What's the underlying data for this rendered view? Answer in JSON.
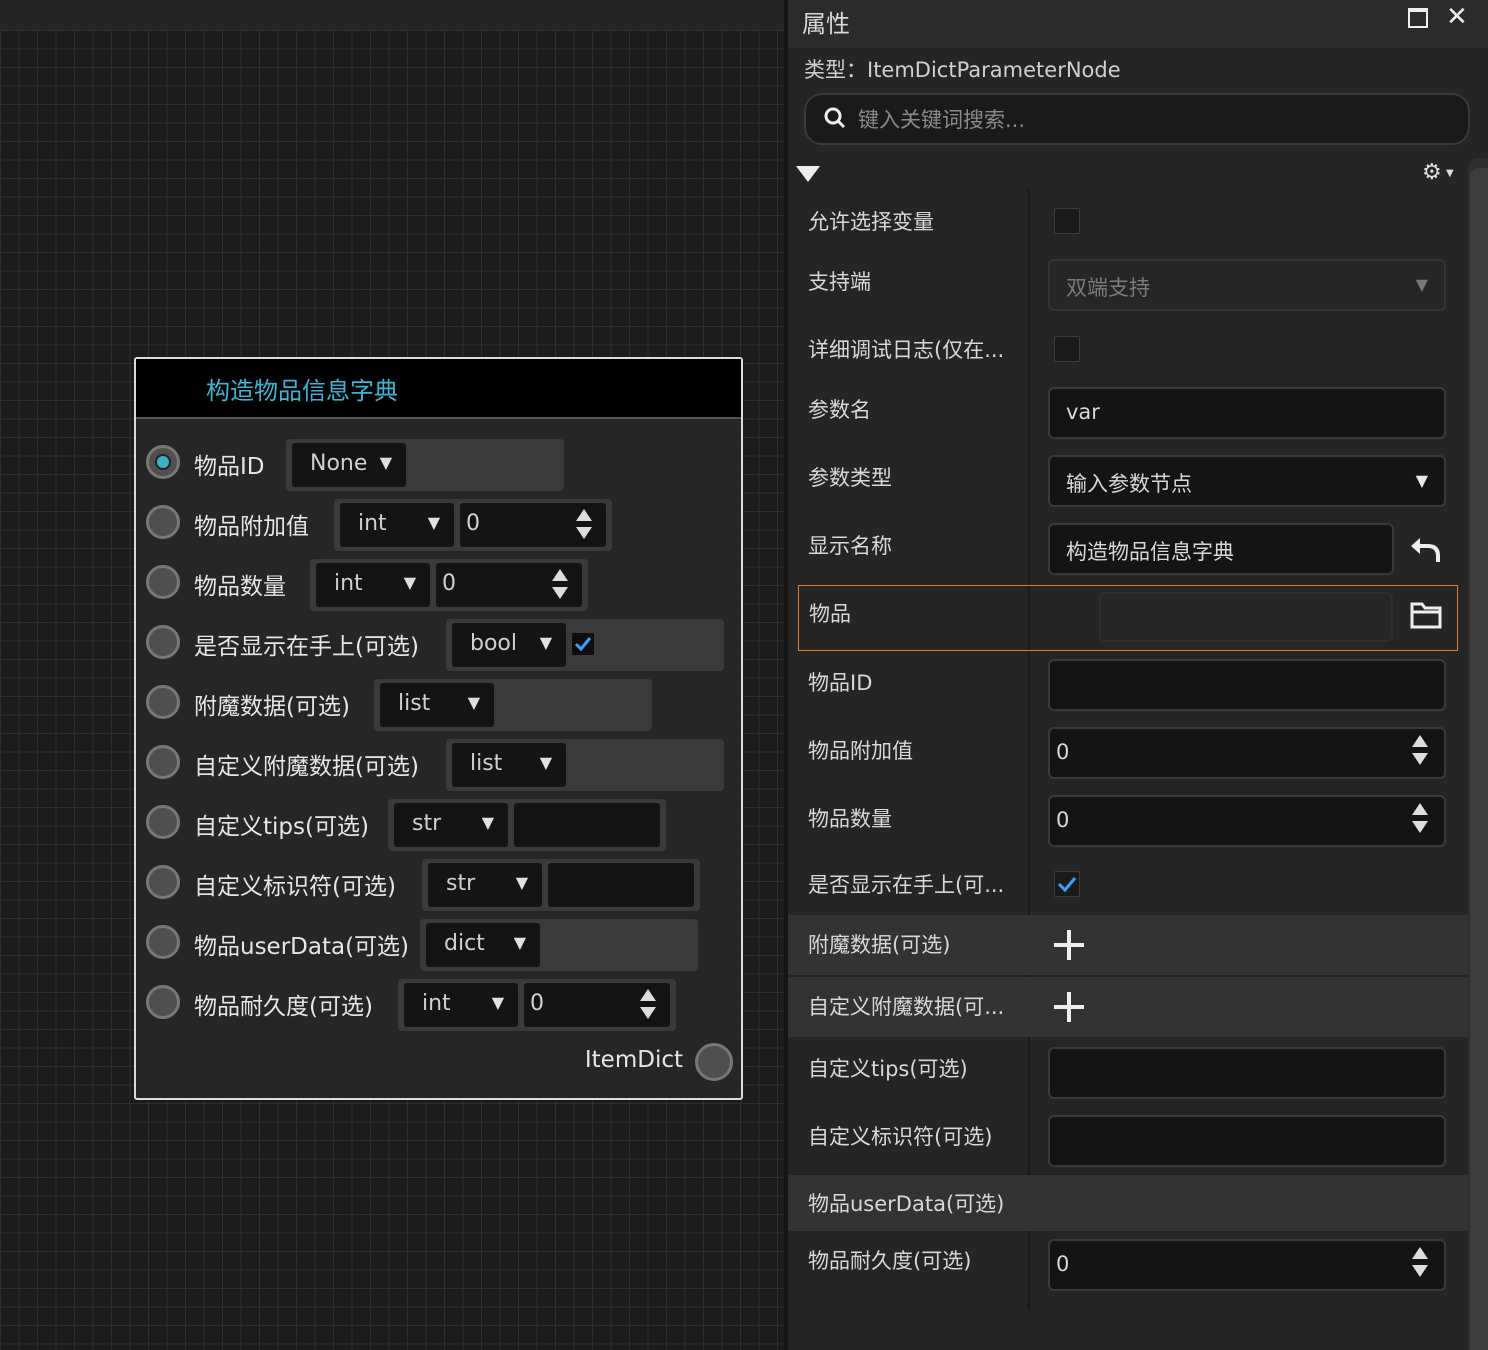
{
  "node": {
    "title": "构造物品信息字典",
    "ports": [
      {
        "label": "物品ID",
        "type": "None",
        "value": null
      },
      {
        "label": "物品附加值",
        "type": "int",
        "value": "0"
      },
      {
        "label": "物品数量",
        "type": "int",
        "value": "0"
      },
      {
        "label": "是否显示在手上(可选)",
        "type": "bool",
        "checked": true
      },
      {
        "label": "附魔数据(可选)",
        "type": "list"
      },
      {
        "label": "自定义附魔数据(可选)",
        "type": "list"
      },
      {
        "label": "自定义tips(可选)",
        "type": "str",
        "value": ""
      },
      {
        "label": "自定义标识符(可选)",
        "type": "str",
        "value": ""
      },
      {
        "label": "物品userData(可选)",
        "type": "dict"
      },
      {
        "label": "物品耐久度(可选)",
        "type": "int",
        "value": "0"
      }
    ],
    "output_label": "ItemDict"
  },
  "panel": {
    "title": "属性",
    "type_line": "类型：ItemDictParameterNode",
    "search_placeholder": "键入关键词搜索...",
    "rows": {
      "allow_select_var": {
        "label": "允许选择变量",
        "checked": false
      },
      "support_side": {
        "label": "支持端",
        "value": "双端支持"
      },
      "debug_log": {
        "label": "详细调试日志(仅在...",
        "checked": false
      },
      "param_name": {
        "label": "参数名",
        "value": "var"
      },
      "param_type": {
        "label": "参数类型",
        "value": "输入参数节点"
      },
      "display_name": {
        "label": "显示名称",
        "value": "构造物品信息字典"
      },
      "item": {
        "label": "物品",
        "value": ""
      },
      "item_id": {
        "label": "物品ID",
        "value": ""
      },
      "item_aux": {
        "label": "物品附加值",
        "value": "0"
      },
      "item_count": {
        "label": "物品数量",
        "value": "0"
      },
      "show_in_hand": {
        "label": "是否显示在手上(可...",
        "checked": true
      },
      "enchant_data": {
        "label": "附魔数据(可选)"
      },
      "custom_enchant": {
        "label": "自定义附魔数据(可..."
      },
      "custom_tips": {
        "label": "自定义tips(可选)",
        "value": ""
      },
      "custom_identifier": {
        "label": "自定义标识符(可选)",
        "value": ""
      },
      "user_data": {
        "label": "物品userData(可选)"
      },
      "durability": {
        "label": "物品耐久度(可选)",
        "value": "0"
      }
    }
  },
  "colors": {
    "accent": "#37b6d8",
    "highlight_border": "#e07a2e",
    "check": "#3aa0ff"
  }
}
